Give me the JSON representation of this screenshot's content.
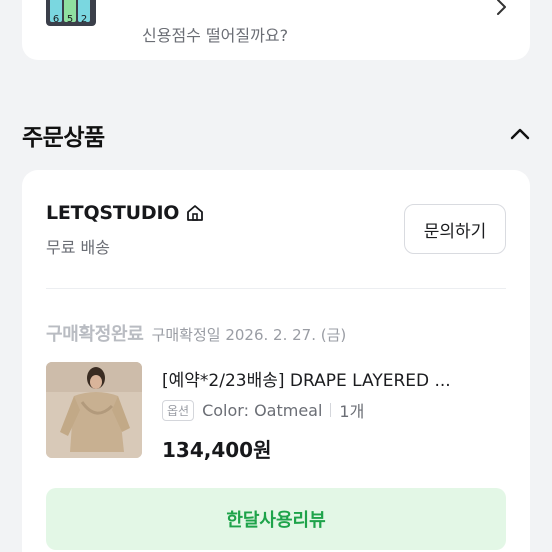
{
  "banner": {
    "text": "신용점수 떨어질까요?",
    "art_digits": [
      "6",
      "5",
      "2"
    ]
  },
  "section": {
    "title": "주문상품"
  },
  "order": {
    "shop_name": "LETQSTUDIO",
    "shipping": "무료 배송",
    "inquiry_label": "문의하기",
    "status": "구매확정완료",
    "status_date": "구매확정일 2026. 2. 27. (금)",
    "product": {
      "name": "[예약*2/23배송] DRAPE LAYERED ...",
      "option_badge": "옵션",
      "option": "Color: Oatmeal",
      "quantity": "1개",
      "price": "134,400원"
    },
    "review_label": "한달사용리뷰"
  },
  "colors": {
    "review_bg": "#e3f7e6",
    "review_text": "#1ea34a",
    "background": "#f2f3f5"
  }
}
